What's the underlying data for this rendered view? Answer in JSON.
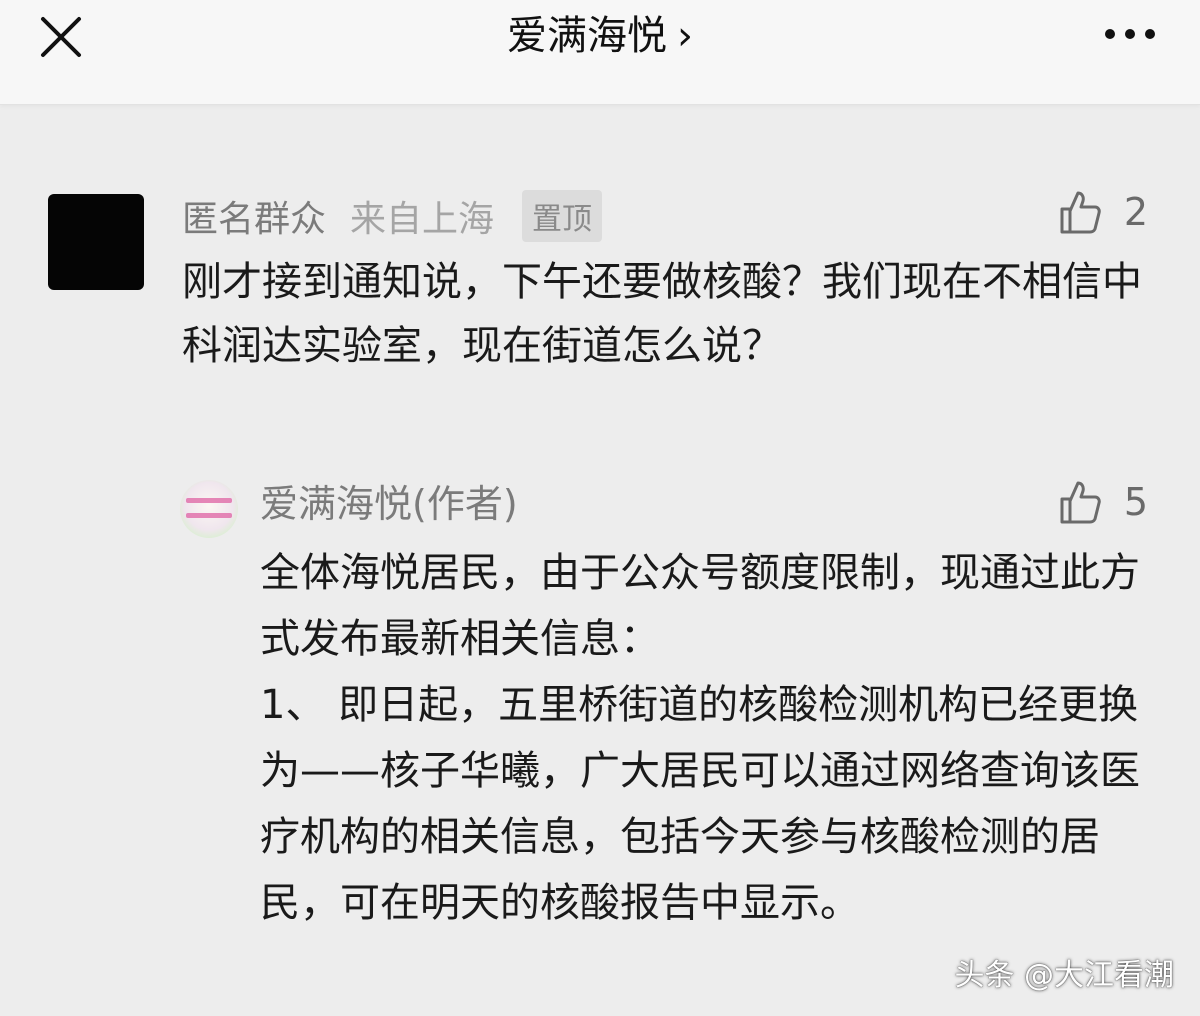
{
  "header": {
    "title": "爱满海悦",
    "chevron": "›",
    "close_icon": "close-icon",
    "more_icon": "more-icon"
  },
  "comment": {
    "author": "匿名群众",
    "location": "来自上海",
    "pin_label": "置顶",
    "likes": "2",
    "text": "刚才接到通知说，下午还要做核酸？我们现在不相信中科润达实验室，现在街道怎么说？"
  },
  "reply": {
    "author": "爱满海悦(作者)",
    "likes": "5",
    "lines": [
      "全体海悦居民，由于公众号额度限制，现通过此方式发布最新相关信息：",
      "1、 即日起，五里桥街道的核酸检测机构已经更换为——核子华曦，广大居民可以通过网络查询该医疗机构的相关信息，包括今天参与核酸检测的居民，可在明天的核酸报告中显示。"
    ]
  },
  "watermark": "头条 @大江看潮",
  "colors": {
    "page_bg": "#ededed",
    "header_bg": "#f7f7f7",
    "meta_text": "#7b7b7b",
    "body_text": "#1a1a1a"
  }
}
